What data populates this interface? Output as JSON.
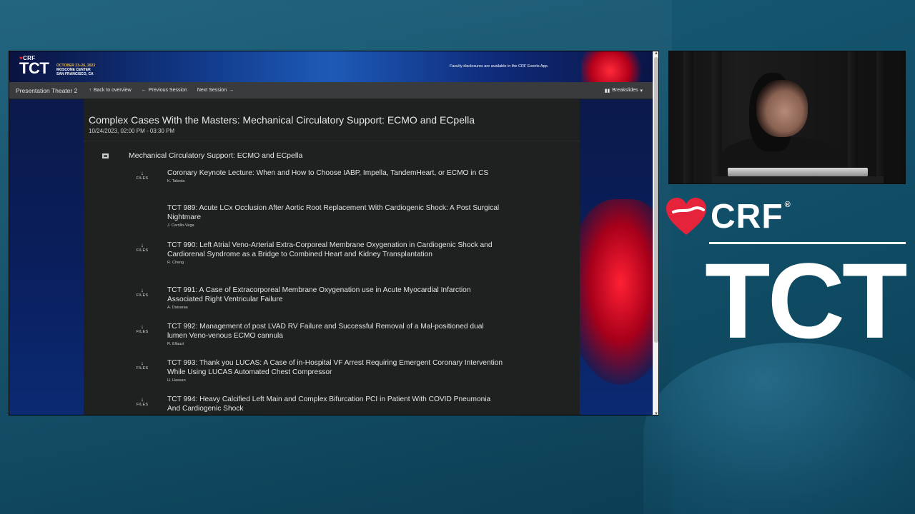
{
  "banner": {
    "crf_label": "CRF",
    "tct_label": "TCT",
    "event_dates": "OCTOBER 23–26, 2023",
    "event_venue": "MOSCONE CENTER",
    "event_city": "SAN FRANCISCO, CA",
    "disclosure": "Faculty disclosures are available in the CRF Events App."
  },
  "nav": {
    "theatre": "Presentation Theater 2",
    "back": "Back to overview",
    "previous": "Previous Session",
    "next": "Next Session",
    "breakslides": "Breakslides"
  },
  "session": {
    "title": "Complex Cases With the Masters: Mechanical Circulatory Support: ECMO and ECpella",
    "datetime": "10/24/2023, 02:00 PM - 03:30 PM",
    "section_title": "Mechanical Circulatory Support: ECMO and ECpella"
  },
  "files_label": "FILES",
  "talks": [
    {
      "title": "Coronary Keynote Lecture: When and How to Choose IABP, Impella, TandemHeart, or ECMO in CS",
      "author": "K. Takeda",
      "has_files": true
    },
    {
      "title": "TCT 989: Acute LCx Occlusion After Aortic Root Replacement With Cardiogenic Shock: A Post Surgical Nightmare",
      "author": "J. Carrillo-Vega",
      "has_files": false
    },
    {
      "title": "TCT 990: Left Atrial Veno-Arterial Extra-Corporeal Membrane Oxygenation in Cardiogenic Shock and Cardiorenal Syndrome as a Bridge to Combined Heart and Kidney Transplantation",
      "author": "R. Cheng",
      "has_files": true
    },
    {
      "title": "TCT 991: A Case of Extracorporeal Membrane Oxygenation use in Acute Myocardial Infarction Associated Right Ventricular Failure",
      "author": "A. Daisaraa",
      "has_files": true
    },
    {
      "title": "TCT 992: Management of post LVAD RV Failure and Successful Removal of a Mal-positioned dual lumen Veno-venous ECMO cannula",
      "author": "R. Ellauzi",
      "has_files": true
    },
    {
      "title": "TCT 993: Thank you LUCAS: A Case of in-Hospital VF Arrest Requiring Emergent Coronary Intervention While Using LUCAS Automated Chest Compressor",
      "author": "H. Hassan",
      "has_files": true
    },
    {
      "title": "TCT 994: Heavy Calcified Left Main and Complex Bifurcation PCI in Patient With COVID Pneumonia And Cardiogenic Shock",
      "author": "",
      "has_files": true
    }
  ],
  "logo": {
    "crf": "CRF",
    "reg": "®",
    "tct": "TCT"
  },
  "colors": {
    "brand_red": "#e5243b",
    "background_teal": "#14536d",
    "panel_dark": "#1f2121"
  }
}
